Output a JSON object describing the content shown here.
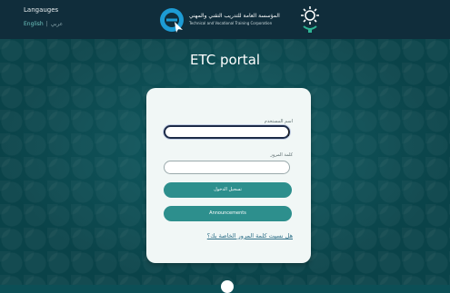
{
  "header": {
    "languages_title": "Langauges",
    "lang_english": "English",
    "lang_separator": "|",
    "lang_arabic": "عربي",
    "corp_name_ar": "المؤسسة العامة للتدريب التقني والمهني",
    "corp_name_en": "Technical and Vocational Training Corporation"
  },
  "main": {
    "title": "ETC portal"
  },
  "login": {
    "username_label": "اسم المستخدم",
    "username_value": "",
    "password_label": "كلمة المرور",
    "password_value": "",
    "login_button": "تسجيل الدخول",
    "announcements_button": "Announcements",
    "forgot_password": "هل نسيت كلمة المرور الخاصة بك؟"
  },
  "colors": {
    "header_bg": "#102d3b",
    "page_bg": "#0c4f56",
    "accent": "#2d8f8d",
    "card_bg": "#f1f7f6",
    "link": "#2d6f88"
  },
  "icons": [
    "etc-logo-icon",
    "tvtc-logo-icon"
  ]
}
